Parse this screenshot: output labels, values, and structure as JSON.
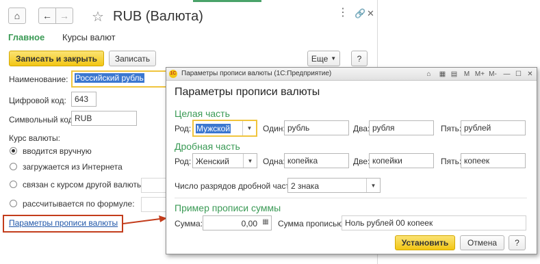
{
  "main": {
    "title": "RUB (Валюта)",
    "tabs": {
      "main": "Главное",
      "rates": "Курсы валют"
    },
    "toolbar": {
      "save_close": "Записать и закрыть",
      "save": "Записать",
      "more": "Еще",
      "help": "?"
    },
    "fields": {
      "name_label": "Наименование:",
      "name_value": "Российский рубль",
      "digital_label": "Цифровой код:",
      "digital_value": "643",
      "symbol_label": "Символьный код:",
      "symbol_value": "RUB"
    },
    "rate_label": "Курс валюты:",
    "rate_options": [
      "вводится вручную",
      "загружается из Интернета",
      "связан с курсом другой валюты:",
      "рассчитывается по формуле:"
    ],
    "params_link": "Параметры прописи валюты"
  },
  "dialog": {
    "window_title": "Параметры прописи валюты  (1С:Предприятие)",
    "heading": "Параметры прописи валюты",
    "whole_title": "Целая часть",
    "whole": {
      "gender_label": "Род:",
      "gender": "Мужской",
      "one_label": "Один:",
      "one": "рубль",
      "two_label": "Два:",
      "two": "рубля",
      "five_label": "Пять:",
      "five": "рублей"
    },
    "fraction_title": "Дробная часть",
    "fraction": {
      "gender_label": "Род:",
      "gender": "Женский",
      "one_label": "Одна:",
      "one": "копейка",
      "two_label": "Две:",
      "two": "копейки",
      "five_label": "Пять:",
      "five": "копеек"
    },
    "digits_label": "Число разрядов дробной части:",
    "digits_value": "2 знака",
    "example_title": "Пример прописи суммы",
    "sum_label": "Сумма:",
    "sum_value": "0,00",
    "words_label": "Сумма прописью:",
    "words_value": "Ноль рублей 00 копеек",
    "install": "Установить",
    "cancel": "Отмена",
    "help": "?",
    "tb_buttons": {
      "m": "M",
      "mplus": "M+",
      "mminus": "M-",
      "minimize": "—",
      "maximize": "☐",
      "close": "✕"
    }
  },
  "colors": {
    "accent_green": "#3a9a55",
    "button_yellow": "#f2c614",
    "arrow_red": "#c33c1b",
    "link_blue": "#1e55a8"
  }
}
